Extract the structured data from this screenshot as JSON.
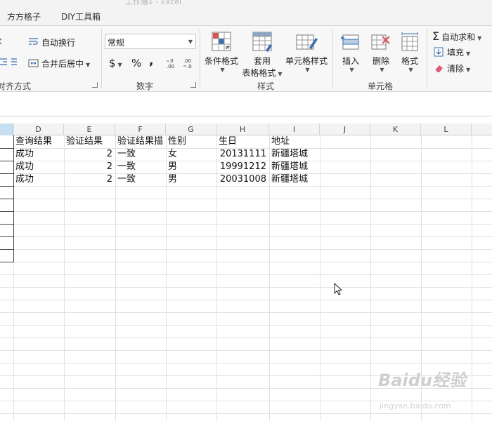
{
  "window": {
    "title_fragment": "工作簿1 - Excel"
  },
  "tabs": [
    "方方格子",
    "DIY工具箱"
  ],
  "ribbon": {
    "alignment": {
      "wrap_text": "自动换行",
      "merge_center": "合并后居中",
      "group_label": "对齐方式"
    },
    "number": {
      "format_value": "常规",
      "currency_symbol": "$",
      "percent_symbol": "%",
      "comma_symbol": ",",
      "increase_decimal": "←.0 .00",
      "decrease_decimal": ".00 →.0",
      "group_label": "数字"
    },
    "styles": {
      "conditional_format": "条件格式",
      "format_as_table_line1": "套用",
      "format_as_table_line2": "表格格式",
      "cell_styles": "单元格样式",
      "group_label": "样式"
    },
    "cells": {
      "insert": "插入",
      "delete": "删除",
      "format": "格式",
      "group_label": "单元格"
    },
    "editing": {
      "autosum": "自动求和",
      "fill": "填充",
      "clear": "清除"
    }
  },
  "sheet": {
    "column_headers": [
      "D",
      "E",
      "F",
      "G",
      "H",
      "I",
      "J",
      "K",
      "L"
    ],
    "header_row": [
      "查询结果",
      "验证结果",
      "验证结果描",
      "性别",
      "生日",
      "地址"
    ],
    "rows": [
      [
        "成功",
        "2",
        "一致",
        "女",
        "20131111",
        "新疆塔城"
      ],
      [
        "成功",
        "2",
        "一致",
        "男",
        "19991212",
        "新疆塔城"
      ],
      [
        "成功",
        "2",
        "一致",
        "男",
        "20031008",
        "新疆塔城"
      ]
    ]
  },
  "watermark": {
    "logo": "Baidu经验",
    "url": "jingyan.baidu.com"
  },
  "colors": {
    "selected_header": "#c7dff0",
    "gridline": "#e1e1e1",
    "ribbon_bg": "#f7f7f7"
  }
}
